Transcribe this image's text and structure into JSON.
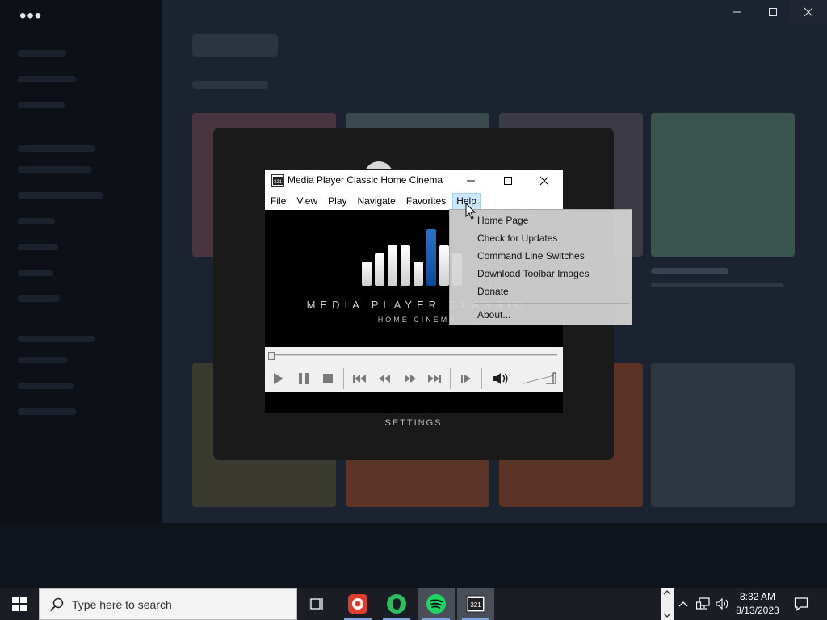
{
  "background_app": {
    "menu_glyph": "•••",
    "window_controls": [
      "minimize-icon",
      "maximize-icon",
      "close-icon"
    ]
  },
  "modal": {
    "settings_label": "SETTINGS"
  },
  "mpc": {
    "title": "Media Player Classic Home Cinema",
    "icon": "mpc-hc-icon",
    "menu": [
      "File",
      "View",
      "Play",
      "Navigate",
      "Favorites",
      "Help"
    ],
    "active_menu": "Help",
    "logo_title": "MEDIA PLAYER CLASSIC",
    "logo_subtitle": "HOME CINEMA",
    "controls": [
      "play-icon",
      "pause-icon",
      "stop-icon",
      "previous-icon",
      "rewind-icon",
      "fast-forward-icon",
      "next-icon",
      "frame-step-icon",
      "volume-icon"
    ]
  },
  "help_menu": {
    "items": [
      "Home Page",
      "Check for Updates",
      "Command Line Switches",
      "Download Toolbar Images",
      "Donate",
      "About..."
    ]
  },
  "taskbar": {
    "search_placeholder": "Type here to search",
    "apps": [
      "task-view-icon",
      "screen-recorder-icon",
      "evernote-icon",
      "spotify-icon",
      "mpc-hc-icon"
    ],
    "time": "8:32 AM",
    "date": "8/13/2023"
  }
}
